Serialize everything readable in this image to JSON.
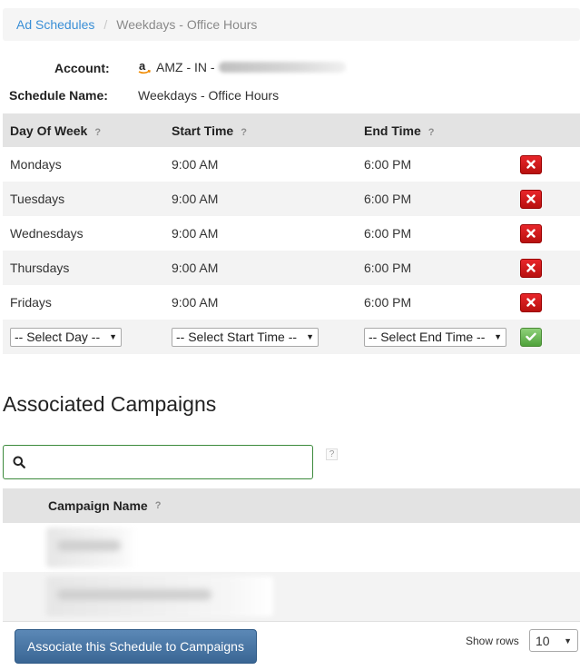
{
  "breadcrumb": {
    "parent": "Ad Schedules",
    "separator": "/",
    "current": "Weekdays - Office Hours"
  },
  "account": {
    "label": "Account:",
    "value": "AMZ - IN -"
  },
  "schedule": {
    "label": "Schedule Name:",
    "value": "Weekdays - Office Hours"
  },
  "schedule_table": {
    "headers": {
      "day": "Day Of Week",
      "start": "Start Time",
      "end": "End Time",
      "help": "?"
    },
    "rows": [
      {
        "day": "Mondays",
        "start": "9:00 AM",
        "end": "6:00 PM"
      },
      {
        "day": "Tuesdays",
        "start": "9:00 AM",
        "end": "6:00 PM"
      },
      {
        "day": "Wednesdays",
        "start": "9:00 AM",
        "end": "6:00 PM"
      },
      {
        "day": "Thursdays",
        "start": "9:00 AM",
        "end": "6:00 PM"
      },
      {
        "day": "Fridays",
        "start": "9:00 AM",
        "end": "6:00 PM"
      }
    ],
    "new_row": {
      "day_select": "-- Select Day --",
      "start_select": "-- Select Start Time --",
      "end_select": "-- Select End Time --"
    }
  },
  "campaigns": {
    "title": "Associated Campaigns",
    "search_help": "?",
    "header": "Campaign Name",
    "header_help": "?"
  },
  "footer": {
    "associate_button": "Associate this Schedule to Campaigns",
    "show_rows_label": "Show rows",
    "rows_value": "10"
  },
  "colors": {
    "link": "#3a8fd6",
    "delete": "#d01a1a",
    "confirm": "#6cbf55",
    "primary_button": "#4a77a5",
    "search_border": "#3c8a3c"
  }
}
